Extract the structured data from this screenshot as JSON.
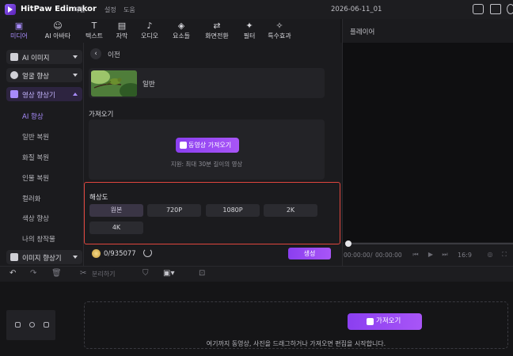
{
  "titlebar": {
    "app_name": "HitPaw Edimakor",
    "menus": [
      "파일",
      "설정",
      "도움"
    ],
    "project_name": "2026-06-11_01"
  },
  "toolbar": {
    "tools": [
      {
        "label": "미디어",
        "icon": "media-icon"
      },
      {
        "label": "AI 아바타",
        "icon": "avatar-icon"
      },
      {
        "label": "텍스트",
        "icon": "text-icon"
      },
      {
        "label": "자막",
        "icon": "subtitle-icon"
      },
      {
        "label": "오디오",
        "icon": "audio-icon"
      },
      {
        "label": "요소들",
        "icon": "elements-icon"
      },
      {
        "label": "화면전환",
        "icon": "transition-icon"
      },
      {
        "label": "필터",
        "icon": "filter-icon"
      },
      {
        "label": "특수효과",
        "icon": "effects-icon"
      }
    ]
  },
  "sidebar": {
    "categories": [
      {
        "label": "AI 이미지"
      },
      {
        "label": "얼굴 향상"
      },
      {
        "label": "영상 향상기"
      },
      {
        "label": "이미지 향상기"
      }
    ],
    "subitems": [
      "AI 향상",
      "일반 복원",
      "화질 복원",
      "인물 복원",
      "컬러화",
      "색상 향상",
      "나의 창작물"
    ]
  },
  "main": {
    "back_label": "이전",
    "mode_label": "일반",
    "import_heading": "가져오기",
    "import_button": "동영상 가져오기",
    "import_hint": "지원: 최대 30분 길이의 영상",
    "resolution_heading": "해상도",
    "resolutions": [
      "원본",
      "720P",
      "1080P",
      "2K",
      "4K"
    ],
    "selected_resolution": "원본",
    "credits": "0/935077",
    "generate_button": "생성"
  },
  "player": {
    "title": "플레이어",
    "time_current": "00:00:00",
    "time_sep": "/",
    "time_total": "00:00:00",
    "ratio": "16:9"
  },
  "timeline": {
    "split_label": "분리하기",
    "import_button": "가져오기",
    "hint": "여기까지 동영상, 사진을 드래그하거나 가져오면 편집을 시작합니다."
  },
  "colors": {
    "accent": "#a855f7",
    "highlight_border": "#e0463e",
    "background": "#151517"
  }
}
